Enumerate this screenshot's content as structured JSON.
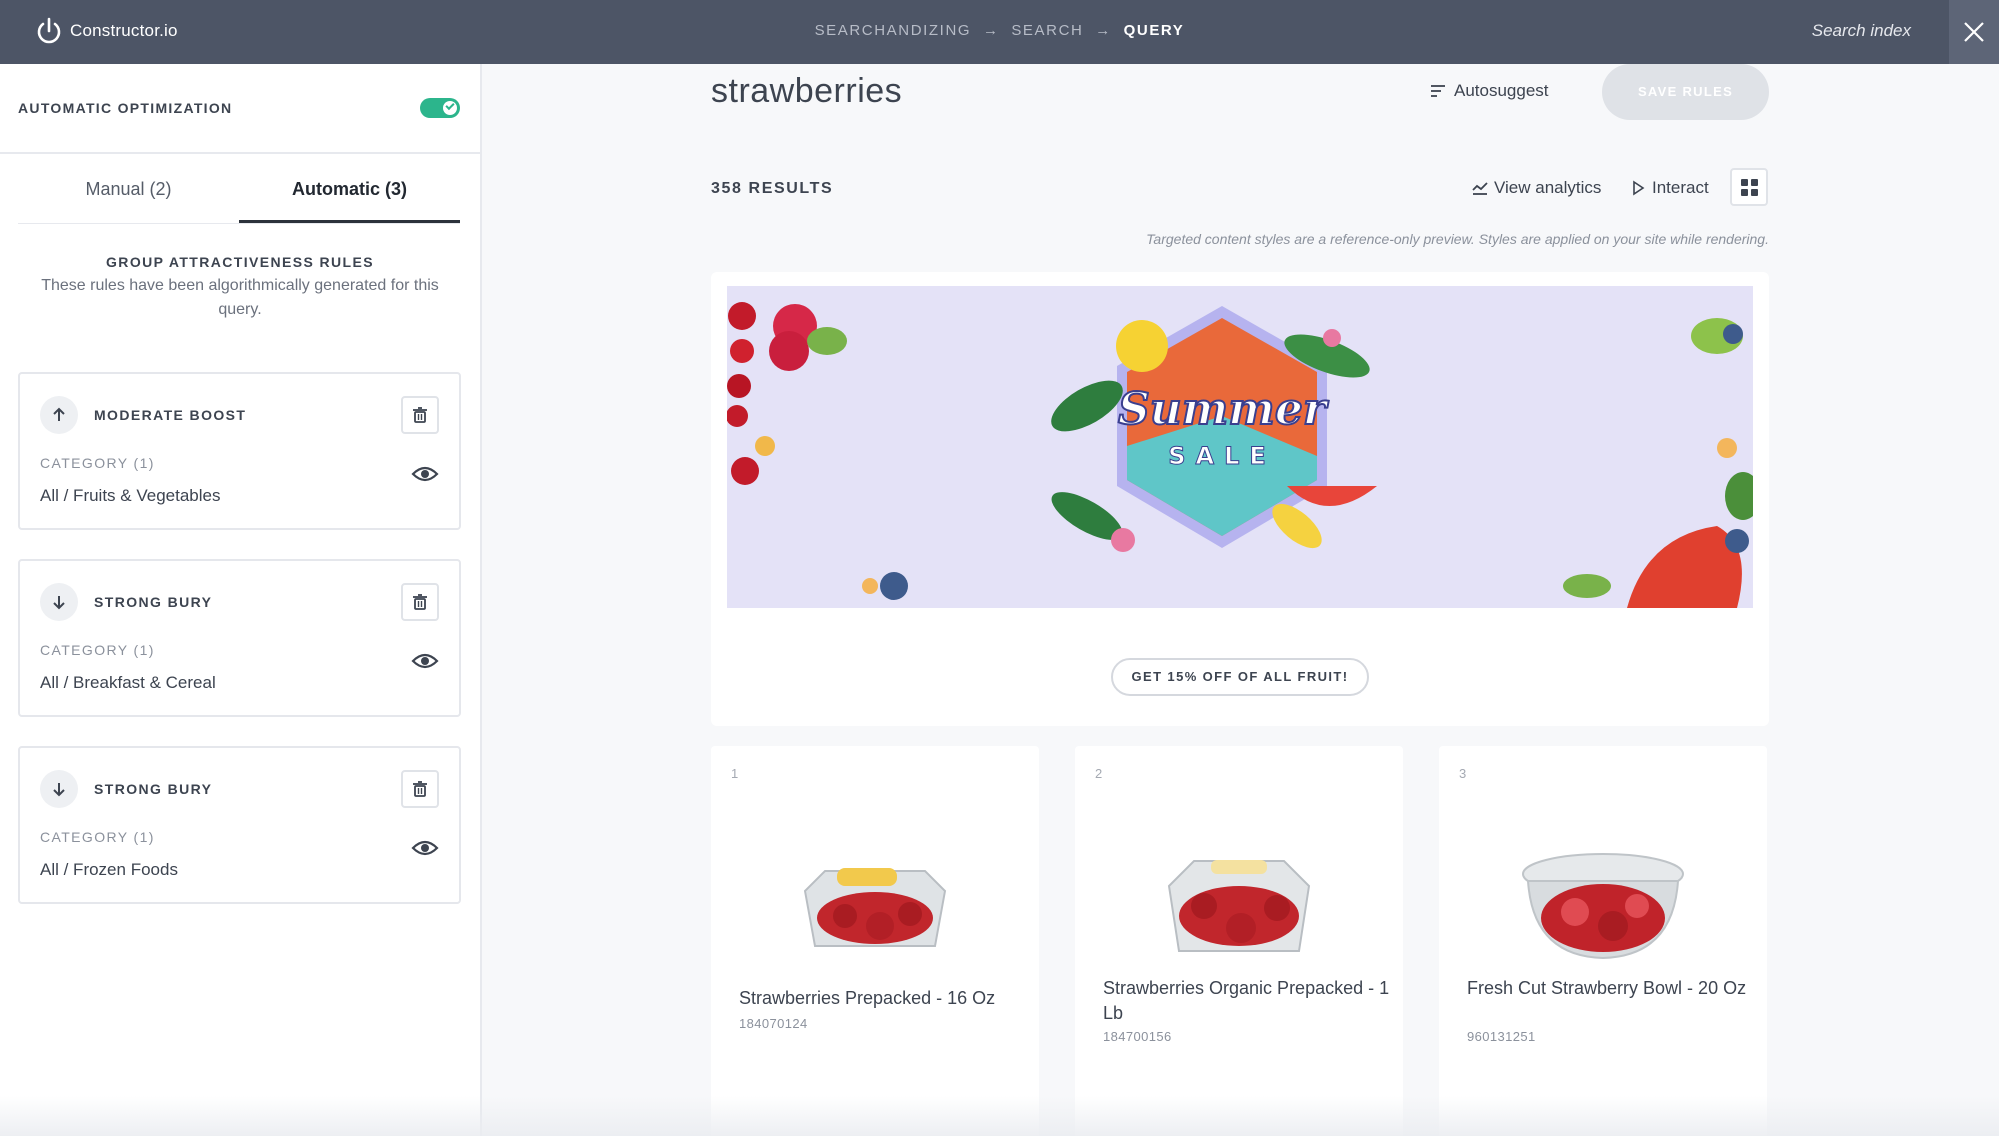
{
  "topbar": {
    "logo_text": "Constructor.io",
    "breadcrumb": [
      "SEARCHANDIZING",
      "SEARCH",
      "QUERY"
    ],
    "breadcrumb_arrow": "→",
    "search_index_label": "Search index",
    "bg_color": "#4d5566"
  },
  "sidebar": {
    "optimization_label": "AUTOMATIC OPTIMIZATION",
    "optimization_enabled": true,
    "toggle_color": "#2cb58c",
    "tabs": [
      {
        "label": "Manual (2)",
        "active": false
      },
      {
        "label": "Automatic (3)",
        "active": true
      }
    ],
    "group_title": "GROUP ATTRACTIVENESS RULES",
    "group_description": "These rules have been algorithmically generated for this query.",
    "rules": [
      {
        "direction": "up",
        "icon": "arrow-up-icon",
        "name": "MODERATE BOOST",
        "category_label": "CATEGORY (1)",
        "category_value": "All / Fruits & Vegetables"
      },
      {
        "direction": "down",
        "icon": "arrow-down-icon",
        "name": "STRONG BURY",
        "category_label": "CATEGORY (1)",
        "category_value": "All / Breakfast & Cereal"
      },
      {
        "direction": "down",
        "icon": "arrow-down-icon",
        "name": "STRONG BURY",
        "category_label": "CATEGORY (1)",
        "category_value": "All / Frozen Foods"
      }
    ]
  },
  "main": {
    "query": "strawberries",
    "autosuggest_label": "Autosuggest",
    "save_rules_label": "SAVE RULES",
    "results_count": "358 RESULTS",
    "view_analytics_label": "View analytics",
    "interact_label": "Interact",
    "preview_note": "Targeted content styles are a reference-only preview. Styles are applied on your site while rendering.",
    "banner": {
      "title_line1": "Summer",
      "title_line2": "SALE",
      "cta_label": "GET 15% OFF OF ALL FRUIT!"
    },
    "products": [
      {
        "rank": "1",
        "name": "Strawberries Prepacked - 16 Oz",
        "sku": "184070124"
      },
      {
        "rank": "2",
        "name": "Strawberries Organic Prepacked - 1 Lb",
        "sku": "184700156"
      },
      {
        "rank": "3",
        "name": "Fresh Cut Strawberry Bowl - 20 Oz",
        "sku": "960131251"
      }
    ]
  }
}
